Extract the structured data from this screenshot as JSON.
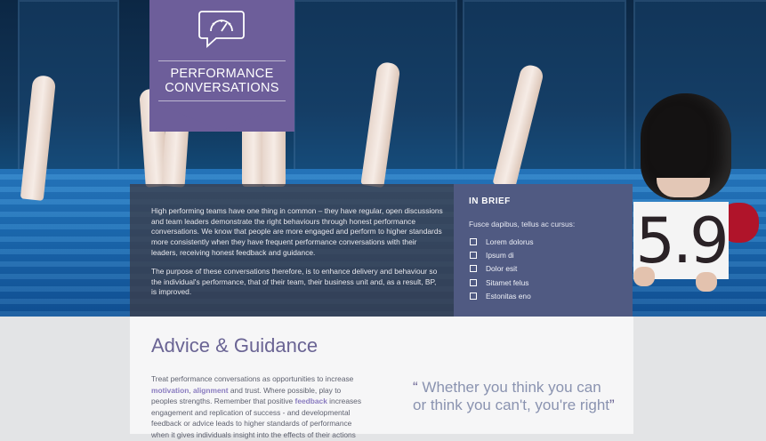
{
  "banner": {
    "title_line1": "PERFORMANCE",
    "title_line2": "CONVERSATIONS"
  },
  "intro": {
    "paragraph1": "High performing teams have one thing in common – they have regular, open discussions and team leaders demonstrate the right behaviours through honest performance conversations.  We know that people are more engaged and perform to higher standards more consistently when they have frequent performance conversations with their leaders, receiving honest feedback and guidance.",
    "paragraph2": "The purpose of these conversations therefore, is to enhance delivery and behaviour so the individual's performance, that of their team, their business unit and, as a result, BP, is improved."
  },
  "brief": {
    "title": "IN BRIEF",
    "subtitle": "Fusce dapibus, tellus ac cursus:",
    "items": [
      "Lorem dolorus",
      "Ipsum di",
      "Dolor esit",
      "Sitamet felus",
      "Estonitas eno"
    ]
  },
  "sign": {
    "value": "5.9"
  },
  "advice": {
    "title": "Advice & Guidance",
    "t1": "Treat performance conversations as opportunities to increase ",
    "link_motivation": "motivation",
    "t2": ", ",
    "link_alignment": "alignment",
    "t3": " and trust. Where possible, play to peoples strengths. Remember that positive ",
    "link_feedback": "feedback",
    "t4": " increases engagement and replication of success - and developmental feedback or advice leads to higher standards of performance when it gives individuals insight into the effects of their actions"
  },
  "quote": {
    "open": "“",
    "text": " Whether you think you can or think you can't, you're right",
    "close": "”"
  },
  "colors": {
    "banner": "#6d5e9a",
    "brief_panel": "#505a82",
    "accent_text": "#6a6494",
    "highlight": "#8a7cc0"
  }
}
